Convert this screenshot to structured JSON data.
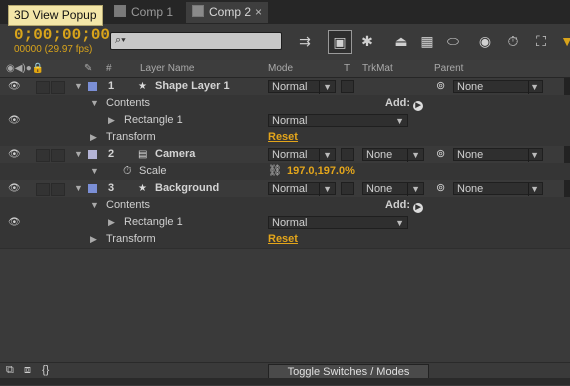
{
  "tooltip": "3D View Popup",
  "tabs": [
    {
      "label": "Comp 1",
      "swatch": "#7a7a7a",
      "active": false
    },
    {
      "label": "Comp 2",
      "swatch": "#8a8a8a",
      "active": true
    }
  ],
  "tab_close": "×",
  "timecode": "0;00;00;00",
  "fps": "00000 (29.97 fps)",
  "search": {
    "icon": "search-icon",
    "placeholder": ""
  },
  "header": {
    "num": "#",
    "layer_name": "Layer Name",
    "mode": "Mode",
    "t": "T",
    "trkmat": "TrkMat",
    "parent": "Parent"
  },
  "layers": [
    {
      "num": "1",
      "name": "Shape Layer 1",
      "color": "#7b8fd6",
      "mode": "Normal",
      "parent": "None"
    },
    {
      "num": "2",
      "name": "Camera",
      "color": "#b4b4d6",
      "mode": "Normal",
      "trkmat": "None",
      "parent": "None"
    },
    {
      "num": "3",
      "name": "Background",
      "color": "#7b8fd6",
      "mode": "Normal",
      "trkmat": "None",
      "parent": "None"
    }
  ],
  "contents_label": "Contents",
  "add_label": "Add:",
  "rectangle_label": "Rectangle 1",
  "rect_mode": "Normal",
  "transform_label": "Transform",
  "reset_label": "Reset",
  "scale_label": "Scale",
  "scale_value": "197.0,197.0%",
  "toggle_label": "Toggle Switches / Modes"
}
